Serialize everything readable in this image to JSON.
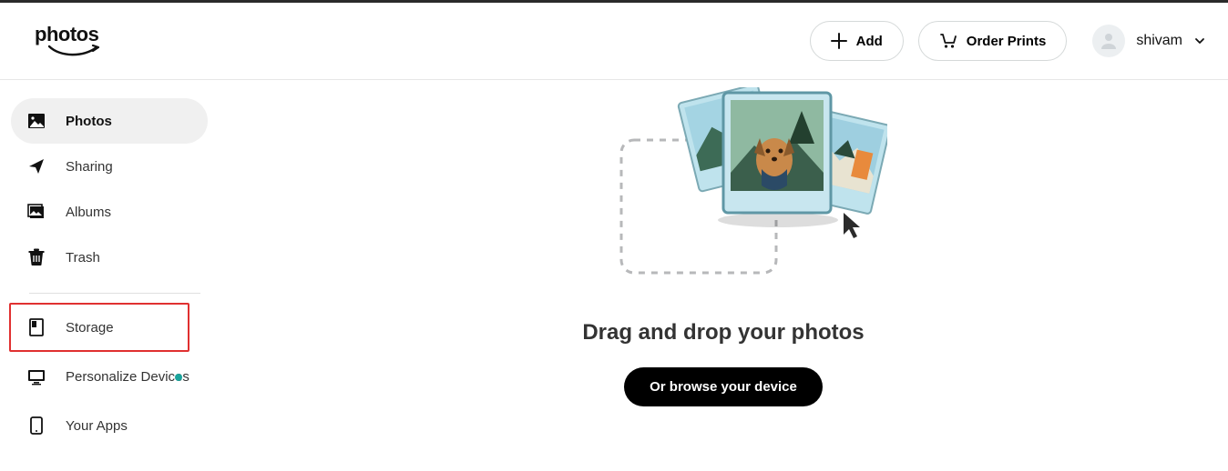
{
  "header": {
    "logo_text": "photos",
    "add_label": "Add",
    "order_prints_label": "Order Prints",
    "user_name": "shivam"
  },
  "sidebar": {
    "photos_label": "Photos",
    "sharing_label": "Sharing",
    "albums_label": "Albums",
    "trash_label": "Trash",
    "storage_label": "Storage",
    "personalize_label": "Personalize Devices",
    "your_apps_label": "Your Apps"
  },
  "main": {
    "drop_title": "Drag and drop your photos",
    "browse_label": "Or browse your device"
  }
}
